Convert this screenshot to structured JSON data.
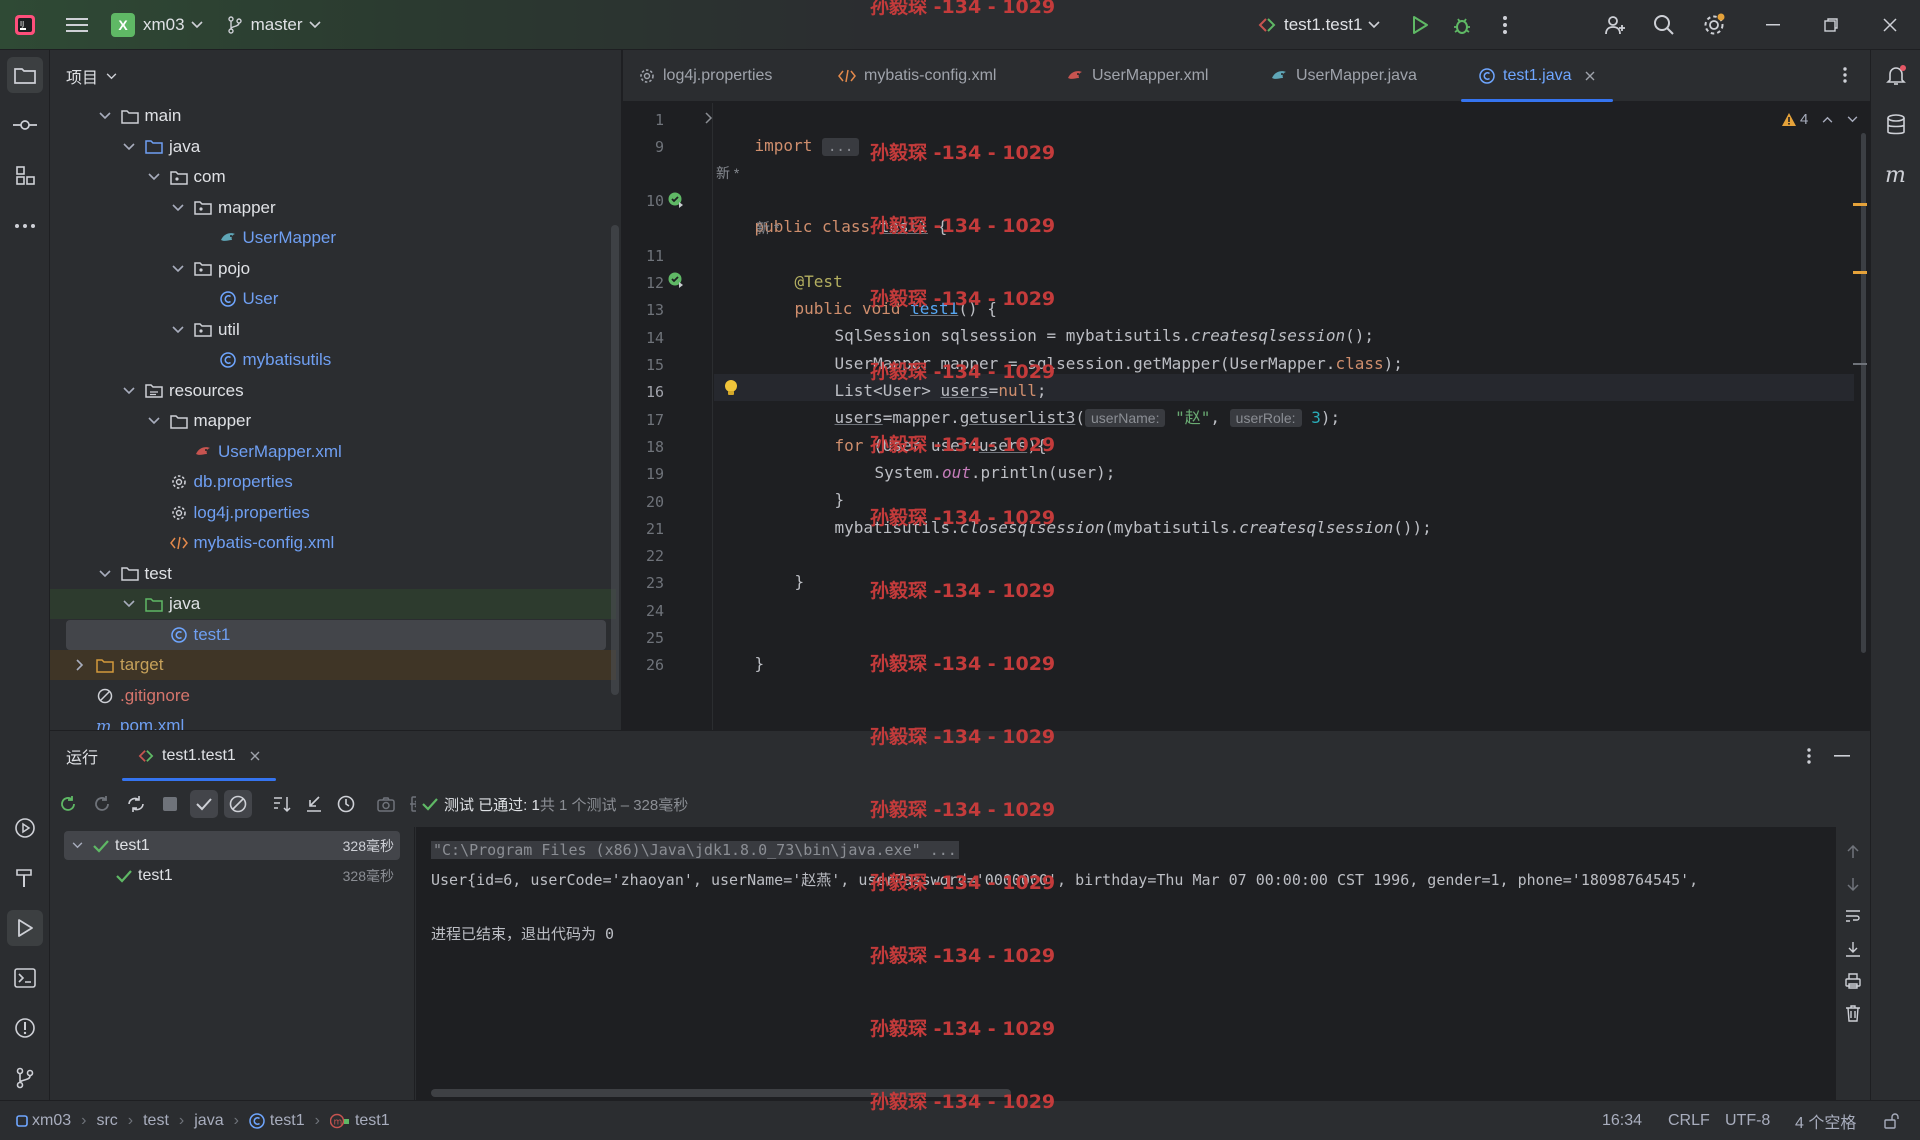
{
  "titlebar": {
    "project_badge": "X",
    "project_name": "xm03",
    "branch": "master",
    "run_config": "test1.test1"
  },
  "project_panel": {
    "title": "项目",
    "tree": [
      {
        "label": "main",
        "kind": "folder",
        "depth": 2,
        "expanded": true
      },
      {
        "label": "java",
        "kind": "src-folder",
        "depth": 3,
        "expanded": true
      },
      {
        "label": "com",
        "kind": "package",
        "depth": 4,
        "expanded": true
      },
      {
        "label": "mapper",
        "kind": "package",
        "depth": 5,
        "expanded": true
      },
      {
        "label": "UserMapper",
        "kind": "mapper-interface",
        "depth": 6
      },
      {
        "label": "pojo",
        "kind": "package",
        "depth": 5,
        "expanded": true
      },
      {
        "label": "User",
        "kind": "class",
        "depth": 6
      },
      {
        "label": "util",
        "kind": "package",
        "depth": 5,
        "expanded": true
      },
      {
        "label": "mybatisutils",
        "kind": "class",
        "depth": 6
      },
      {
        "label": "resources",
        "kind": "res-folder",
        "depth": 3,
        "expanded": true
      },
      {
        "label": "mapper",
        "kind": "folder",
        "depth": 4,
        "expanded": true
      },
      {
        "label": "UserMapper.xml",
        "kind": "mapper-xml",
        "depth": 5
      },
      {
        "label": "db.properties",
        "kind": "properties",
        "depth": 4
      },
      {
        "label": "log4j.properties",
        "kind": "properties",
        "depth": 4
      },
      {
        "label": "mybatis-config.xml",
        "kind": "xml",
        "depth": 4
      },
      {
        "label": "test",
        "kind": "folder",
        "depth": 2,
        "expanded": true
      },
      {
        "label": "java",
        "kind": "test-folder",
        "depth": 3,
        "expanded": true
      },
      {
        "label": "test1",
        "kind": "class",
        "depth": 4,
        "selected": true
      },
      {
        "label": "target",
        "kind": "excluded-folder",
        "depth": 1,
        "expanded": false
      },
      {
        "label": ".gitignore",
        "kind": "ignore",
        "depth": 1
      },
      {
        "label": "pom.xml",
        "kind": "maven",
        "depth": 1
      }
    ]
  },
  "editor_tabs": [
    {
      "label": "log4j.properties",
      "icon": "gear-icon"
    },
    {
      "label": "mybatis-config.xml",
      "icon": "xml-icon"
    },
    {
      "label": "UserMapper.xml",
      "icon": "mapper-xml-icon"
    },
    {
      "label": "UserMapper.java",
      "icon": "mapper-icon"
    },
    {
      "label": "test1.java",
      "icon": "class-icon",
      "active": true
    }
  ],
  "editor": {
    "warning_count": "4",
    "new_hint": "新 *",
    "line_numbers": [
      "1",
      "9",
      "10",
      "11",
      "12",
      "13",
      "14",
      "15",
      "16",
      "17",
      "18",
      "19",
      "20",
      "21",
      "22",
      "23",
      "24",
      "25",
      "26"
    ],
    "code": {
      "import_kw": "import",
      "import_fold": "...",
      "class_decl_kw": "public class",
      "class_name": "test1",
      "brace_open": " {",
      "annotation": "@Test",
      "method_kw": "public void",
      "method_name": "test1",
      "method_tail": "() {",
      "l13_a": "SqlSession sqlsession = mybatisutils.",
      "l13_b": "createsqlsession",
      "l13_c": "();",
      "l14_a": "UserMapper mapper = sqlsession.getMapper(UserMapper.",
      "l14_b": "class",
      "l14_c": ");",
      "l15_a": "List<User> ",
      "l15_b": "users",
      "l15_c": "=",
      "l15_d": "null",
      "l15_e": ";",
      "l16_a": "users",
      "l16_b": "=mapper.",
      "l16_c": "getuserlist3",
      "l16_d": "(",
      "l16_hint1": "userName:",
      "l16_str": "\"赵\"",
      "l16_comma": ", ",
      "l16_hint2": "userRole:",
      "l16_num": "3",
      "l16_end": ");",
      "l17_a": "for",
      "l17_b": " (User user:",
      "l17_c": "users",
      "l17_d": "){",
      "l18_a": "System.",
      "l18_b": "out",
      "l18_c": ".println(user);",
      "l19": "}",
      "l20_a": "mybatisutils.",
      "l20_b": "closesqlsession",
      "l20_c": "(mybatisutils.",
      "l20_d": "createsqlsession",
      "l20_e": "());",
      "l22": "}",
      "l25": "}"
    }
  },
  "run_panel": {
    "title": "运行",
    "tab_label": "test1.test1",
    "tests": [
      {
        "label": "test1",
        "time": "328毫秒"
      },
      {
        "label": "test1",
        "time": "328毫秒"
      }
    ],
    "status_pass": "测试 已通过: 1",
    "status_detail": "共 1 个测试 – 328毫秒",
    "console": [
      "\"C:\\Program Files (x86)\\Java\\jdk1.8.0_73\\bin\\java.exe\" ...",
      "User{id=6, userCode='zhaoyan', userName='赵燕', userPassword='0000000', birthday=Thu Mar 07 00:00:00 CST 1996, gender=1, phone='18098764545',",
      "",
      "进程已结束，退出代码为 0"
    ]
  },
  "statusbar": {
    "crumbs": [
      "xm03",
      "src",
      "test",
      "java",
      "test1",
      "test1"
    ],
    "position": "16:34",
    "line_sep": "CRLF",
    "encoding": "UTF-8",
    "indent": "4 个空格"
  },
  "watermark": "孙毅琛 -134 - 1029",
  "colors": {
    "accent": "#3574f0",
    "pass_green": "#5fb865",
    "watermark_red": "#c43b3b"
  }
}
